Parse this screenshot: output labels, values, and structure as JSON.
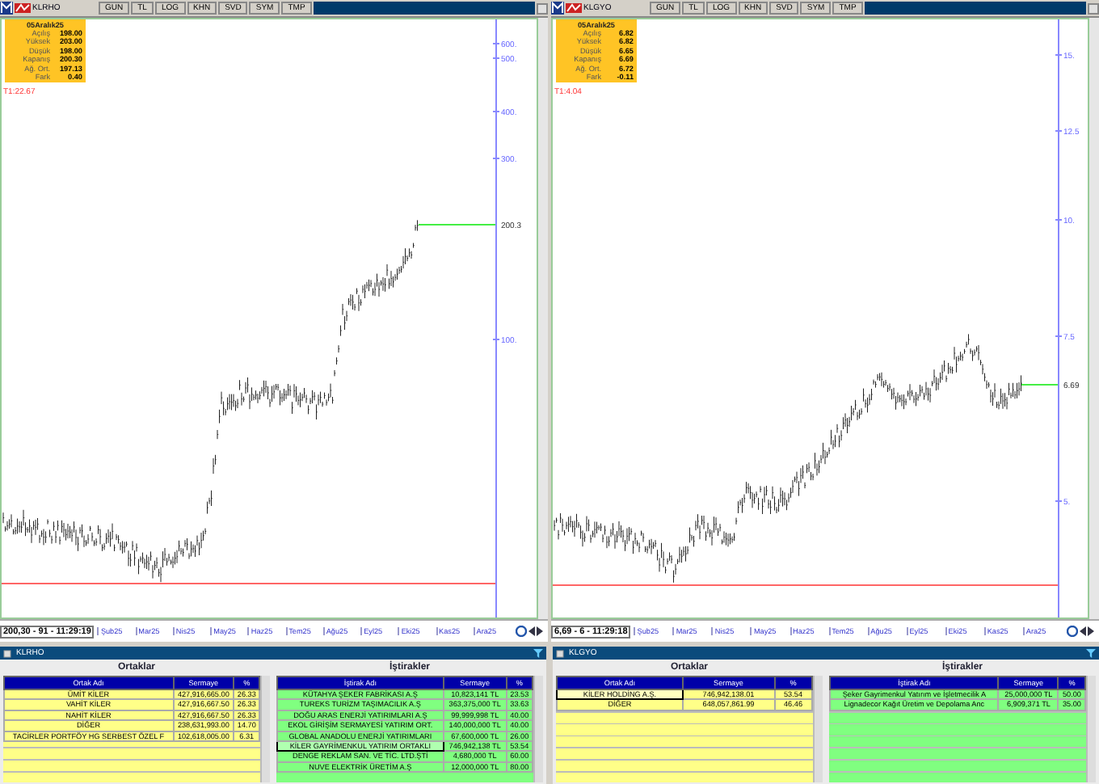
{
  "panes": [
    {
      "symbol": "KLRHO",
      "toolbar_buttons": [
        "GUN",
        "TL",
        "LOG",
        "KHN",
        "SVD",
        "SYM",
        "TMP"
      ],
      "info": {
        "date": "05Aralık25",
        "rows": [
          {
            "label": "Açılış",
            "value": "198.00"
          },
          {
            "label": "Yüksek",
            "value": "203.00"
          },
          {
            "label": "Düşük",
            "value": "198.00"
          },
          {
            "label": "Kapanış",
            "value": "200.30"
          },
          {
            "label": "Ağ. Ort.",
            "value": "197.13"
          },
          {
            "label": "Fark",
            "value": "0.40"
          }
        ]
      },
      "t1_label": "T1:22.67",
      "axis_labels": [
        "600.",
        "500.",
        "400.",
        "300.",
        "100."
      ],
      "last_price": "200.3",
      "status": "200,30 - 91 - 11:29:19",
      "months": [
        "Şub25",
        "Mar25",
        "Nis25",
        "May25",
        "Haz25",
        "Tem25",
        "Ağu25",
        "Eyl25",
        "Eki25",
        "Kas25",
        "Ara25"
      ]
    },
    {
      "symbol": "KLGYO",
      "toolbar_buttons": [
        "GUN",
        "TL",
        "LOG",
        "KHN",
        "SVD",
        "SYM",
        "TMP"
      ],
      "info": {
        "date": "05Aralık25",
        "rows": [
          {
            "label": "Açılış",
            "value": "6.82"
          },
          {
            "label": "Yüksek",
            "value": "6.82"
          },
          {
            "label": "Düşük",
            "value": "6.65"
          },
          {
            "label": "Kapanış",
            "value": "6.69"
          },
          {
            "label": "Ağ. Ort.",
            "value": "6.72"
          },
          {
            "label": "Fark",
            "value": "-0.11"
          }
        ]
      },
      "t1_label": "T1:4.04",
      "axis_labels": [
        "15.",
        "12.5",
        "10.",
        "7.5",
        "5."
      ],
      "last_price": "6.69",
      "status": "6,69 - 6 - 11:29:18",
      "months": [
        "Şub25",
        "Mar25",
        "Nis25",
        "May25",
        "Haz25",
        "Tem25",
        "Ağu25",
        "Eyl25",
        "Eki25",
        "Kas25",
        "Ara25"
      ]
    }
  ],
  "panels": [
    {
      "symbol": "KLRHO",
      "partners": {
        "title": "Ortaklar",
        "columns": [
          "Ortak Adı",
          "Sermaye",
          "%"
        ],
        "rows": [
          {
            "cells": [
              "ÜMİT KİLER",
              "427,916,665.00",
              "26.33"
            ],
            "selected": false
          },
          {
            "cells": [
              "VAHİT KİLER",
              "427,916,667.50",
              "26.33"
            ],
            "selected": false
          },
          {
            "cells": [
              "NAHİT KİLER",
              "427,916,667.50",
              "26.33"
            ],
            "selected": false
          },
          {
            "cells": [
              "DİĞER",
              "238,631,993.00",
              "14.70"
            ],
            "selected": false
          },
          {
            "cells": [
              "TACİRLER PORTFÖY HG SERBEST ÖZEL F",
              "102,618,005.00",
              "6.31"
            ],
            "selected": false
          }
        ]
      },
      "affiliates": {
        "title": "İştirakler",
        "columns": [
          "İştirak Adı",
          "Sermaye",
          "%"
        ],
        "rows": [
          {
            "cells": [
              "KÜTAHYA ŞEKER FABRİKASI A.Ş",
              "10,823,141 TL",
              "23.53"
            ],
            "selected": false
          },
          {
            "cells": [
              "TUREKS TURİZM TAŞIMACILIK A.Ş",
              "363,375,000 TL",
              "33.63"
            ],
            "selected": false
          },
          {
            "cells": [
              "DOĞU ARAS ENERJİ YATIRIMLARI A.Ş",
              "99,999,998 TL",
              "40.00"
            ],
            "selected": false
          },
          {
            "cells": [
              "EKOL GİRİŞİM SERMAYESİ YATIRIM ORT.",
              "140,000,000 TL",
              "40.00"
            ],
            "selected": false
          },
          {
            "cells": [
              "GLOBAL ANADOLU ENERJİ YATIRIMLARI",
              "67,600,000 TL",
              "26.00"
            ],
            "selected": false
          },
          {
            "cells": [
              "KİLER GAYRİMENKUL YATIRIM ORTAKLI",
              "746,942,138 TL",
              "53.54"
            ],
            "selected": true
          },
          {
            "cells": [
              "DENGE REKLAM SAN. VE TİC. LTD.ŞTİ",
              "4,680,000 TL",
              "60.00"
            ],
            "selected": false
          },
          {
            "cells": [
              "NUVE ELEKTRİK ÜRETİM A.Ş",
              "12,000,000 TL",
              "80.00"
            ],
            "selected": false
          }
        ]
      }
    },
    {
      "symbol": "KLGYO",
      "partners": {
        "title": "Ortaklar",
        "columns": [
          "Ortak Adı",
          "Sermaye",
          "%"
        ],
        "rows": [
          {
            "cells": [
              "KİLER HOLDİNG A.Ş.",
              "746,942,138.01",
              "53.54"
            ],
            "selected": true
          },
          {
            "cells": [
              "DİĞER",
              "648,057,861.99",
              "46.46"
            ],
            "selected": false
          }
        ]
      },
      "affiliates": {
        "title": "İştirakler",
        "columns": [
          "İştirak Adı",
          "Sermaye",
          "%"
        ],
        "rows": [
          {
            "cells": [
              "Şeker Gayrimenkul Yatırım ve İşletmecilik A",
              "25,000,000 TL",
              "50.00"
            ],
            "selected": false
          },
          {
            "cells": [
              "Lignadecor Kağıt Üretim ve Depolama Anc",
              "6,909,371 TL",
              "35.00"
            ],
            "selected": false
          }
        ]
      }
    }
  ]
}
